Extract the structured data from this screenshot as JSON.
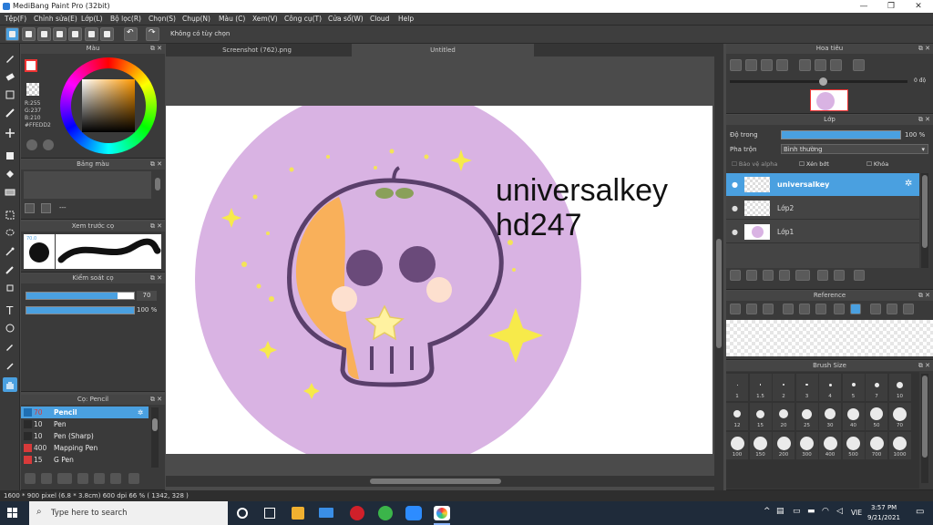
{
  "window": {
    "title": "MediBang Paint Pro (32bit)"
  },
  "menu": [
    "Tệp(F)",
    "Chỉnh sửa(E)",
    "Lớp(L)",
    "Bộ lọc(R)",
    "Chọn(S)",
    "Chụp(N)",
    "Màu (C)",
    "Xem(V)",
    "Công cụ(T)",
    "Cửa sổ(W)",
    "Cloud",
    "Help"
  ],
  "toolbar": {
    "option_text": "Không có tùy chọn"
  },
  "color_panel": {
    "title": "Màu",
    "r": "R:255",
    "g": "G:237",
    "b": "B:210",
    "hex": "#FFEDD2"
  },
  "palette_panel": {
    "title": "Bảng màu",
    "dash": "---"
  },
  "preview_panel": {
    "title": "Xem trước cọ",
    "size": "70.0"
  },
  "brush_control": {
    "title": "Kiểm soát cọ",
    "size_value": "70",
    "opacity_value": "100 %",
    "size_fraction": 0.85,
    "opacity_fraction": 1.0
  },
  "brush_list": {
    "title": "Cọ: Pencil",
    "items": [
      {
        "size": "70",
        "name": "Pencil",
        "color": "#1f6fb3",
        "selected": true
      },
      {
        "size": "10",
        "name": "Pen",
        "color": "#2a2a2a",
        "selected": false
      },
      {
        "size": "10",
        "name": "Pen (Sharp)",
        "color": "#2a2a2a",
        "selected": false
      },
      {
        "size": "400",
        "name": "Mapping Pen",
        "color": "#d83a3a",
        "selected": false
      },
      {
        "size": "15",
        "name": "G Pen",
        "color": "#d83a3a",
        "selected": false
      }
    ]
  },
  "tabs": [
    {
      "label": "Screenshot (762).png"
    },
    {
      "label": "Untitled"
    }
  ],
  "canvas": {
    "line1": "universalkey",
    "line2": "hd247"
  },
  "navigator": {
    "title": "Hoa tiêu",
    "zoom": "0 độ"
  },
  "layers": {
    "title": "Lớp",
    "opacity_label": "Độ trong",
    "opacity_value": "100 %",
    "blend_label": "Pha trộn",
    "blend_value": "Bình thường",
    "protect_alpha": "Bảo vệ alpha",
    "clipping": "Xén bớt",
    "lock": "Khóa",
    "items": [
      {
        "name": "universalkey",
        "selected": true
      },
      {
        "name": "Lớp2",
        "selected": false
      },
      {
        "name": "Lớp1",
        "selected": false
      }
    ]
  },
  "reference": {
    "title": "Reference"
  },
  "brush_size": {
    "title": "Brush Size",
    "row1": [
      "1",
      "1.5",
      "2",
      "3",
      "4",
      "5",
      "7",
      "10"
    ],
    "row2": [
      "12",
      "15",
      "20",
      "25",
      "30",
      "40",
      "50",
      "70"
    ],
    "row3": [
      "100",
      "150",
      "200",
      "300",
      "400",
      "500",
      "700",
      "1000"
    ]
  },
  "status": {
    "text": "1600 * 900 pixel   (6.8 * 3.8cm)   600 dpi   66 %   ( 1342, 328 )"
  },
  "taskbar": {
    "search_placeholder": "Type here to search",
    "lang": "VIE",
    "time": "3:57 PM",
    "date": "9/21/2021"
  },
  "colors": {
    "accent": "#4aa0e0",
    "canvas_circle": "#d9b3e3",
    "ink": "#5a3f6b"
  }
}
